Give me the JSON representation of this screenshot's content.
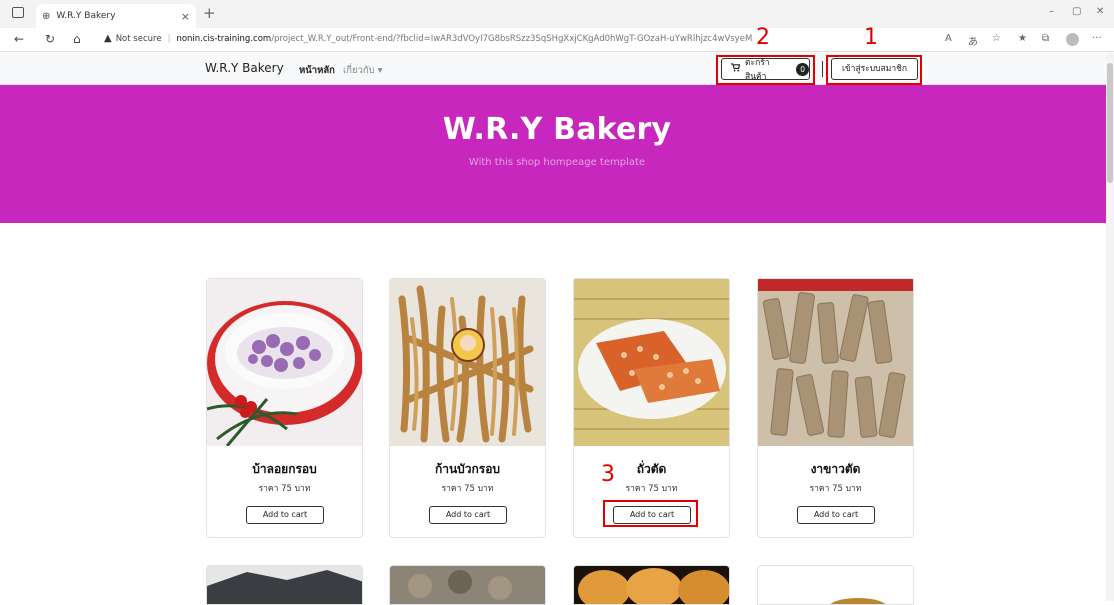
{
  "browser": {
    "tab_title": "W.R.Y Bakery",
    "tab_close": "×",
    "new_tab": "+",
    "security_label": "Not secure",
    "url_host": "nonin.cis-training.com",
    "url_path": "/project_W.R.Y_out/Front-end/?fbclid=IwAR3dVOyI7G8bsRSzz3SqSHgXxjCKgAd0hWgT-GOzaH-uYwRlhjzc4wVsyeM",
    "window_controls": [
      "–",
      "▢",
      "✕"
    ],
    "icons": [
      "back-icon",
      "refresh-icon",
      "home-icon",
      "read-aloud-icon",
      "translate-icon",
      "favorite-icon",
      "favorites-icon",
      "collections-icon",
      "profile-icon",
      "more-icon"
    ]
  },
  "navbar": {
    "brand": "W.R.Y Bakery",
    "home": "หน้าหลัก",
    "about": "เกี่ยวกับ ▾",
    "cart_label": "ตะกร้าสินค้า",
    "cart_count": "0",
    "login_label": "เข้าสู่ระบบสมาชิก"
  },
  "hero": {
    "title": "W.R.Y Bakery",
    "subtitle": "With this shop hompeage template",
    "color": "#c727bd"
  },
  "annotations": {
    "n1": "1",
    "n2": "2",
    "n3": "3",
    "color": "#e30000"
  },
  "products": [
    {
      "name": "บ้าลอยกรอบ",
      "price": "ราคา 75 บาท",
      "button": "Add to cart"
    },
    {
      "name": "ก้านบัวกรอบ",
      "price": "ราคา 75 บาท",
      "button": "Add to cart"
    },
    {
      "name": "ถั่วตัด",
      "price": "ราคา 75 บาท",
      "button": "Add to cart"
    },
    {
      "name": "งาขาวตัด",
      "price": "ราคา 75 บาท",
      "button": "Add to cart"
    }
  ]
}
